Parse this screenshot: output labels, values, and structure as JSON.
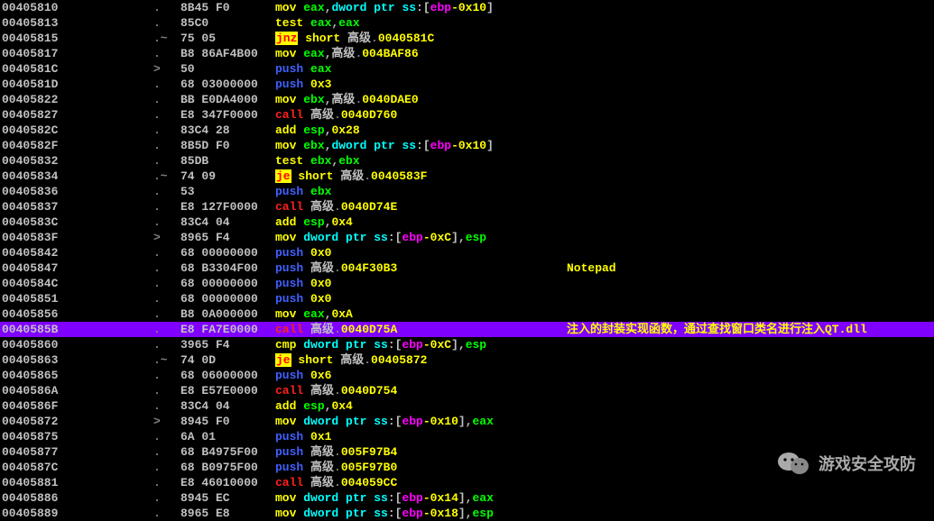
{
  "watermark": "游戏安全攻防",
  "rows": [
    {
      "addr": "00405810",
      "mark": ".",
      "bytes": "8B45 F0",
      "dis": [
        [
          "y",
          "mov "
        ],
        [
          "g",
          "eax"
        ],
        [
          "w",
          ","
        ],
        [
          "cy",
          "dword ptr ss"
        ],
        [
          "w",
          ":["
        ],
        [
          "mg",
          "ebp"
        ],
        [
          "y",
          "-0x10"
        ],
        [
          "w",
          "]"
        ]
      ]
    },
    {
      "addr": "00405813",
      "mark": ".",
      "bytes": "85C0",
      "dis": [
        [
          "y",
          "test "
        ],
        [
          "g",
          "eax"
        ],
        [
          "w",
          ","
        ],
        [
          "g",
          "eax"
        ]
      ]
    },
    {
      "addr": "00405815",
      "mark": ".~",
      "bytes": "75 05",
      "dis": [
        [
          "j",
          "jnz"
        ],
        [
          "y",
          " short "
        ],
        [
          "w",
          "高级"
        ],
        [
          "lg",
          "."
        ],
        [
          "y",
          "0040581C"
        ]
      ]
    },
    {
      "addr": "00405817",
      "mark": ".",
      "bytes": "B8 86AF4B00",
      "dis": [
        [
          "y",
          "mov "
        ],
        [
          "g",
          "eax"
        ],
        [
          "w",
          ",高级"
        ],
        [
          "lg",
          "."
        ],
        [
          "y",
          "004BAF86"
        ]
      ]
    },
    {
      "addr": "0040581C",
      "mark": ">",
      "bytes": "50",
      "dis": [
        [
          "bl",
          "push "
        ],
        [
          "g",
          "eax"
        ]
      ]
    },
    {
      "addr": "0040581D",
      "mark": ".",
      "bytes": "68 03000000",
      "dis": [
        [
          "bl",
          "push "
        ],
        [
          "y",
          "0x3"
        ]
      ]
    },
    {
      "addr": "00405822",
      "mark": ".",
      "bytes": "BB E0DA4000",
      "dis": [
        [
          "y",
          "mov "
        ],
        [
          "g",
          "ebx"
        ],
        [
          "w",
          ",高级"
        ],
        [
          "lg",
          "."
        ],
        [
          "y",
          "0040DAE0"
        ]
      ]
    },
    {
      "addr": "00405827",
      "mark": ".",
      "bytes": "E8 347F0000",
      "dis": [
        [
          "r",
          "call "
        ],
        [
          "w",
          "高级"
        ],
        [
          "lg",
          "."
        ],
        [
          "y",
          "0040D760"
        ]
      ]
    },
    {
      "addr": "0040582C",
      "mark": ".",
      "bytes": "83C4 28",
      "dis": [
        [
          "y",
          "add "
        ],
        [
          "g",
          "esp"
        ],
        [
          "w",
          ","
        ],
        [
          "y",
          "0x28"
        ]
      ]
    },
    {
      "addr": "0040582F",
      "mark": ".",
      "bytes": "8B5D F0",
      "dis": [
        [
          "y",
          "mov "
        ],
        [
          "g",
          "ebx"
        ],
        [
          "w",
          ","
        ],
        [
          "cy",
          "dword ptr ss"
        ],
        [
          "w",
          ":["
        ],
        [
          "mg",
          "ebp"
        ],
        [
          "y",
          "-0x10"
        ],
        [
          "w",
          "]"
        ]
      ]
    },
    {
      "addr": "00405832",
      "mark": ".",
      "bytes": "85DB",
      "dis": [
        [
          "y",
          "test "
        ],
        [
          "g",
          "ebx"
        ],
        [
          "w",
          ","
        ],
        [
          "g",
          "ebx"
        ]
      ]
    },
    {
      "addr": "00405834",
      "mark": ".~",
      "bytes": "74 09",
      "dis": [
        [
          "j",
          "je"
        ],
        [
          "y",
          " short "
        ],
        [
          "w",
          "高级"
        ],
        [
          "lg",
          "."
        ],
        [
          "y",
          "0040583F"
        ]
      ]
    },
    {
      "addr": "00405836",
      "mark": ".",
      "bytes": "53",
      "dis": [
        [
          "bl",
          "push "
        ],
        [
          "g",
          "ebx"
        ]
      ]
    },
    {
      "addr": "00405837",
      "mark": ".",
      "bytes": "E8 127F0000",
      "dis": [
        [
          "r",
          "call "
        ],
        [
          "w",
          "高级"
        ],
        [
          "lg",
          "."
        ],
        [
          "y",
          "0040D74E"
        ]
      ]
    },
    {
      "addr": "0040583C",
      "mark": ".",
      "bytes": "83C4 04",
      "dis": [
        [
          "y",
          "add "
        ],
        [
          "g",
          "esp"
        ],
        [
          "w",
          ","
        ],
        [
          "y",
          "0x4"
        ]
      ]
    },
    {
      "addr": "0040583F",
      "mark": ">",
      "bytes": "8965 F4",
      "dis": [
        [
          "y",
          "mov "
        ],
        [
          "cy",
          "dword ptr ss"
        ],
        [
          "w",
          ":["
        ],
        [
          "mg",
          "ebp"
        ],
        [
          "y",
          "-0xC"
        ],
        [
          "w",
          "],"
        ],
        [
          "g",
          "esp"
        ]
      ]
    },
    {
      "addr": "00405842",
      "mark": ".",
      "bytes": "68 00000000",
      "dis": [
        [
          "bl",
          "push "
        ],
        [
          "y",
          "0x0"
        ]
      ]
    },
    {
      "addr": "00405847",
      "mark": ".",
      "bytes": "68 B3304F00",
      "dis": [
        [
          "bl",
          "push "
        ],
        [
          "w",
          "高级"
        ],
        [
          "lg",
          "."
        ],
        [
          "y",
          "004F30B3"
        ]
      ],
      "cmt": "Notepad"
    },
    {
      "addr": "0040584C",
      "mark": ".",
      "bytes": "68 00000000",
      "dis": [
        [
          "bl",
          "push "
        ],
        [
          "y",
          "0x0"
        ]
      ]
    },
    {
      "addr": "00405851",
      "mark": ".",
      "bytes": "68 00000000",
      "dis": [
        [
          "bl",
          "push "
        ],
        [
          "y",
          "0x0"
        ]
      ]
    },
    {
      "addr": "00405856",
      "mark": ".",
      "bytes": "B8 0A000000",
      "dis": [
        [
          "y",
          "mov "
        ],
        [
          "g",
          "eax"
        ],
        [
          "w",
          ","
        ],
        [
          "y",
          "0xA"
        ]
      ]
    },
    {
      "addr": "0040585B",
      "mark": ".",
      "bytes": "E8 FA7E0000",
      "dis": [
        [
          "r",
          "call "
        ],
        [
          "w",
          "高级"
        ],
        [
          "lg",
          "."
        ],
        [
          "y",
          "0040D75A"
        ]
      ],
      "cmt": "注入的封装实现函数，通过查找窗口类名进行注入QT.dll",
      "hl": true
    },
    {
      "addr": "00405860",
      "mark": ".",
      "bytes": "3965 F4",
      "dis": [
        [
          "y",
          "cmp "
        ],
        [
          "cy",
          "dword ptr ss"
        ],
        [
          "w",
          ":["
        ],
        [
          "mg",
          "ebp"
        ],
        [
          "y",
          "-0xC"
        ],
        [
          "w",
          "],"
        ],
        [
          "g",
          "esp"
        ]
      ]
    },
    {
      "addr": "00405863",
      "mark": ".~",
      "bytes": "74 0D",
      "dis": [
        [
          "j",
          "je"
        ],
        [
          "y",
          " short "
        ],
        [
          "w",
          "高级"
        ],
        [
          "lg",
          "."
        ],
        [
          "y",
          "00405872"
        ]
      ]
    },
    {
      "addr": "00405865",
      "mark": ".",
      "bytes": "68 06000000",
      "dis": [
        [
          "bl",
          "push "
        ],
        [
          "y",
          "0x6"
        ]
      ]
    },
    {
      "addr": "0040586A",
      "mark": ".",
      "bytes": "E8 E57E0000",
      "dis": [
        [
          "r",
          "call "
        ],
        [
          "w",
          "高级"
        ],
        [
          "lg",
          "."
        ],
        [
          "y",
          "0040D754"
        ]
      ]
    },
    {
      "addr": "0040586F",
      "mark": ".",
      "bytes": "83C4 04",
      "dis": [
        [
          "y",
          "add "
        ],
        [
          "g",
          "esp"
        ],
        [
          "w",
          ","
        ],
        [
          "y",
          "0x4"
        ]
      ]
    },
    {
      "addr": "00405872",
      "mark": ">",
      "bytes": "8945 F0",
      "dis": [
        [
          "y",
          "mov "
        ],
        [
          "cy",
          "dword ptr ss"
        ],
        [
          "w",
          ":["
        ],
        [
          "mg",
          "ebp"
        ],
        [
          "y",
          "-0x10"
        ],
        [
          "w",
          "],"
        ],
        [
          "g",
          "eax"
        ]
      ]
    },
    {
      "addr": "00405875",
      "mark": ".",
      "bytes": "6A 01",
      "dis": [
        [
          "bl",
          "push "
        ],
        [
          "y",
          "0x1"
        ]
      ]
    },
    {
      "addr": "00405877",
      "mark": ".",
      "bytes": "68 B4975F00",
      "dis": [
        [
          "bl",
          "push "
        ],
        [
          "w",
          "高级"
        ],
        [
          "lg",
          "."
        ],
        [
          "y",
          "005F97B4"
        ]
      ]
    },
    {
      "addr": "0040587C",
      "mark": ".",
      "bytes": "68 B0975F00",
      "dis": [
        [
          "bl",
          "push "
        ],
        [
          "w",
          "高级"
        ],
        [
          "lg",
          "."
        ],
        [
          "y",
          "005F97B0"
        ]
      ]
    },
    {
      "addr": "00405881",
      "mark": ".",
      "bytes": "E8 46010000",
      "dis": [
        [
          "r",
          "call "
        ],
        [
          "w",
          "高级"
        ],
        [
          "lg",
          "."
        ],
        [
          "y",
          "004059CC"
        ]
      ]
    },
    {
      "addr": "00405886",
      "mark": ".",
      "bytes": "8945 EC",
      "dis": [
        [
          "y",
          "mov "
        ],
        [
          "cy",
          "dword ptr ss"
        ],
        [
          "w",
          ":["
        ],
        [
          "mg",
          "ebp"
        ],
        [
          "y",
          "-0x14"
        ],
        [
          "w",
          "],"
        ],
        [
          "g",
          "eax"
        ]
      ]
    },
    {
      "addr": "00405889",
      "mark": ".",
      "bytes": "8965 E8",
      "dis": [
        [
          "y",
          "mov "
        ],
        [
          "cy",
          "dword ptr ss"
        ],
        [
          "w",
          ":["
        ],
        [
          "mg",
          "ebp"
        ],
        [
          "y",
          "-0x18"
        ],
        [
          "w",
          "],"
        ],
        [
          "g",
          "esp"
        ]
      ]
    }
  ]
}
